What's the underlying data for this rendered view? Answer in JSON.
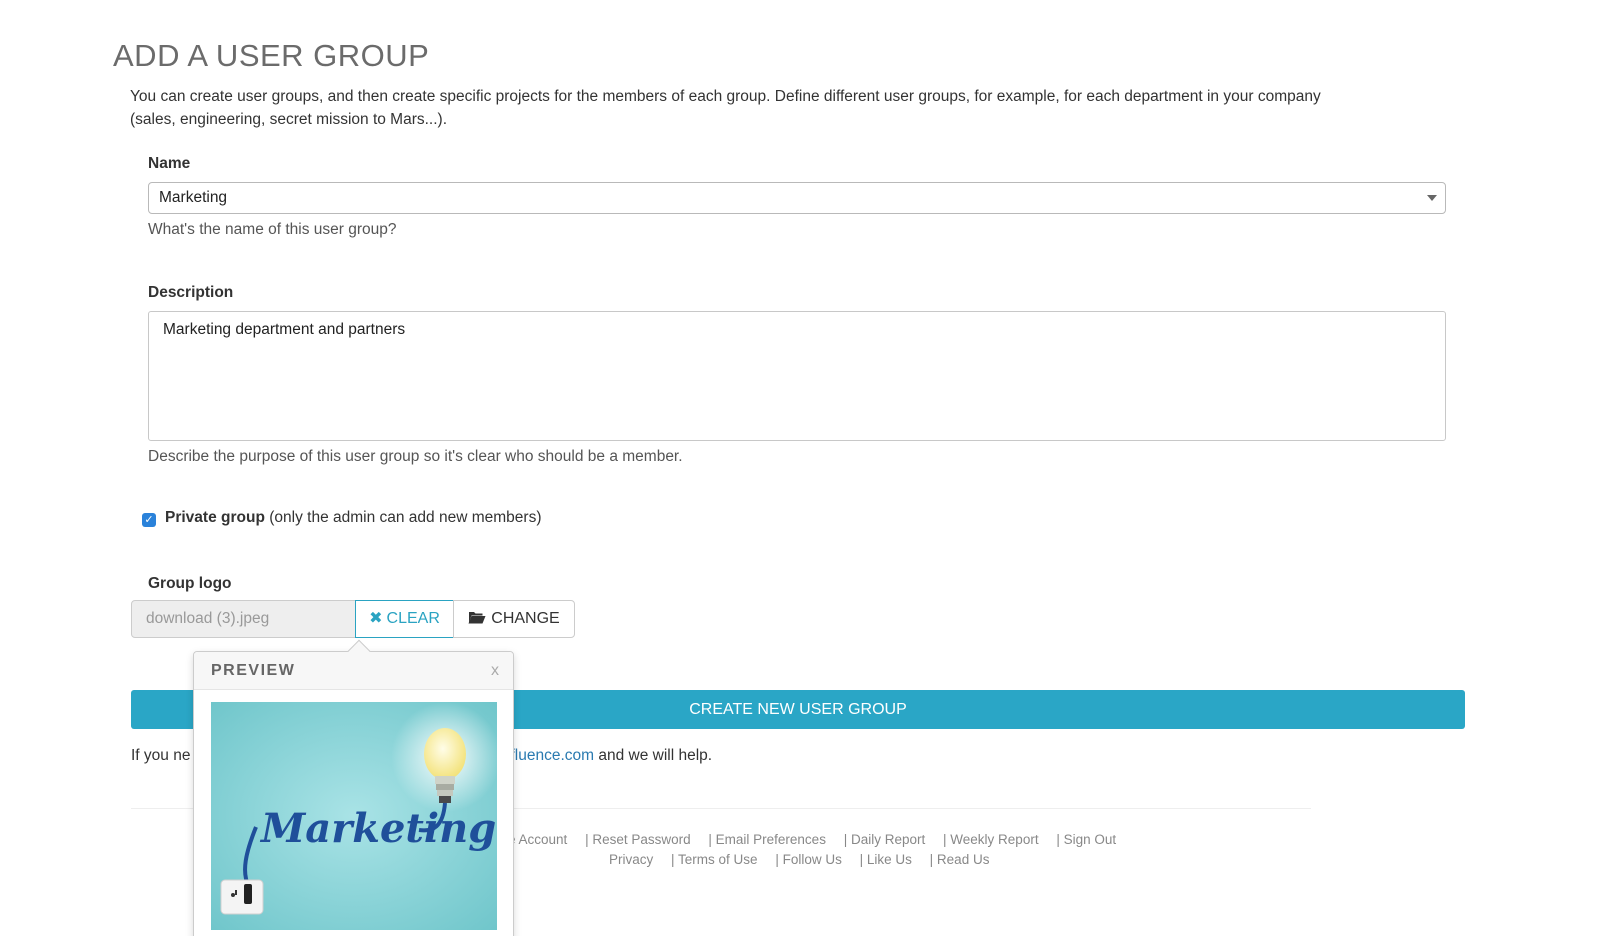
{
  "page": {
    "title": "ADD A USER GROUP",
    "intro": "You can create user groups, and then create specific projects for the members of each group. Define different user groups, for example, for each department in your company (sales, engineering, secret mission to Mars...)."
  },
  "form": {
    "name": {
      "label": "Name",
      "value": "Marketing",
      "help": "What's the name of this user group?"
    },
    "description": {
      "label": "Description",
      "value": "Marketing department and partners",
      "help": "Describe the purpose of this user group so it's clear who should be a member."
    },
    "private": {
      "checked": true,
      "label_bold": "Private group",
      "label_rest": "(only the admin can add new members)"
    },
    "logo": {
      "label": "Group logo",
      "filename": "download (3).jpeg",
      "clear_label": "CLEAR",
      "change_label": "CHANGE"
    },
    "submit_label": "CREATE NEW USER GROUP"
  },
  "footnote": {
    "visible_start": "If you ne",
    "link_fragment": "fluence.com",
    "visible_end": "and we will help."
  },
  "preview": {
    "title": "PREVIEW",
    "close": "x",
    "image_text": "Marketing"
  },
  "footer": {
    "row1": [
      "e Account",
      "| Reset Password",
      "| Email Preferences",
      "| Daily Report",
      "| Weekly Report",
      "| Sign Out"
    ],
    "row2": [
      "Privacy",
      "| Terms of Use",
      "| Follow Us",
      "| Like Us",
      "| Read Us"
    ]
  },
  "colors": {
    "accent": "#2aa6c6",
    "checkbox": "#2a82da",
    "link": "#2a7ab0"
  }
}
